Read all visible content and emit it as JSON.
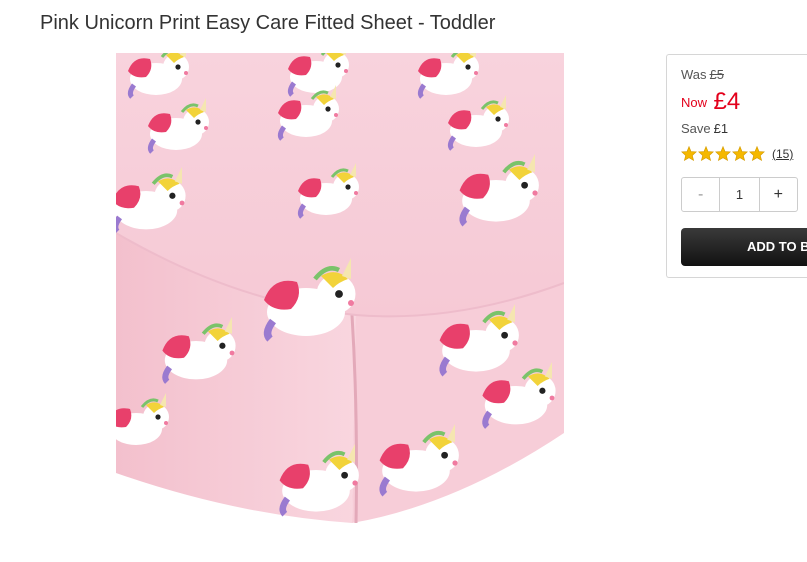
{
  "product": {
    "title": "Pink Unicorn Print Easy Care Fitted Sheet - Toddler",
    "image_alt": "Pink unicorn print fitted sheet"
  },
  "pricing": {
    "was_label": "Was",
    "was_price": "£5",
    "now_label": "Now",
    "now_price": "£4",
    "save_label": "Save",
    "save_value": "£1"
  },
  "rating": {
    "stars": 5,
    "max_stars": 5,
    "review_count": "(15)",
    "star_color": "#f5b800"
  },
  "quantity": {
    "decrement": "-",
    "value": "1",
    "increment": "+"
  },
  "cart": {
    "add_label": "ADD TO BASKET"
  },
  "colors": {
    "price_red": "#e3001b",
    "sheet_pink": "#f6c9d5"
  }
}
